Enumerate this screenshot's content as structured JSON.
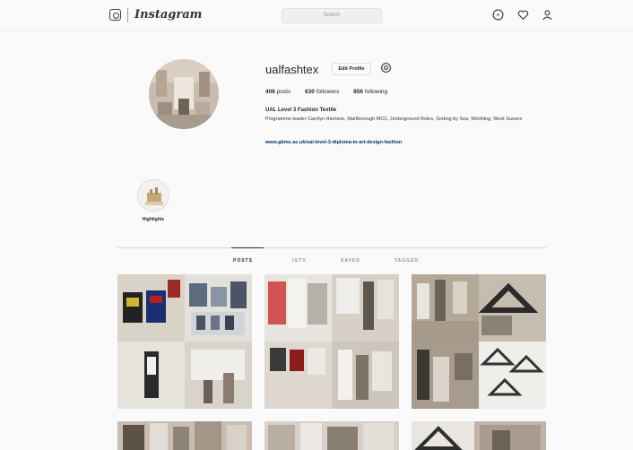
{
  "app": {
    "logo_text": "Instagram",
    "search_placeholder": "Search"
  },
  "profile": {
    "username": "ualfashtex",
    "edit_button": "Edit Profile",
    "stats": {
      "posts": "406",
      "posts_label": "posts",
      "followers": "630",
      "followers_label": "followers",
      "following": "856",
      "following_label": "following"
    },
    "bio_name": "UAL Level 3 Fashion Textile",
    "bio_text": "Programme leader Carolyn Harrison, Marlborough MCC, Underground Roles, Sorting by Sea, Worthing, West Sussex",
    "bio_link": "www.gbmc.ac.uk/ual-level-3-diploma-in-art-design-fashion"
  },
  "highlights": [
    {
      "label": "Highlights"
    }
  ],
  "tabs": [
    {
      "label": "POSTS",
      "active": true
    },
    {
      "label": "IGTV",
      "active": false
    },
    {
      "label": "SAVED",
      "active": false
    },
    {
      "label": "TAGGED",
      "active": false
    }
  ],
  "colors": {
    "background": "#fafafa",
    "text": "#262626",
    "link": "#00376b",
    "border": "#dbdbdb"
  }
}
